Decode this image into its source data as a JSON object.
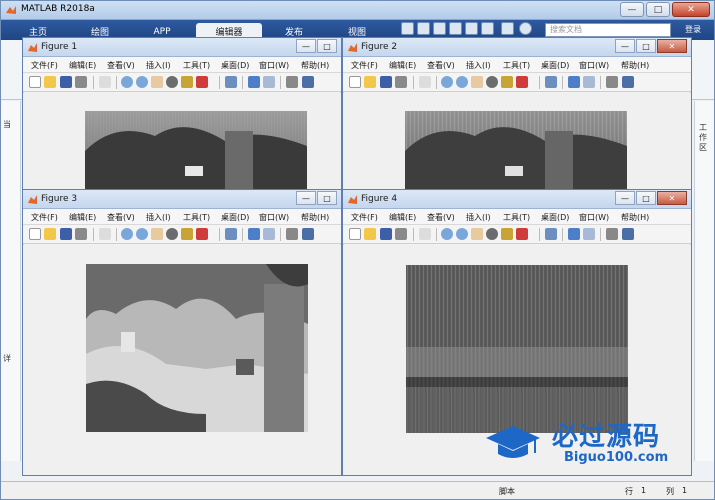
{
  "app": {
    "title": "MATLAB R2018a",
    "tabs": [
      "主页",
      "绘图",
      "APP",
      "编辑器",
      "发布",
      "视图"
    ],
    "active_tab": "编辑器",
    "search_placeholder": "搜索文档",
    "login_label": "登录",
    "left_labels": [
      "当",
      "详"
    ],
    "right_panel_label": "工作区",
    "statusbar": {
      "mode": "脚本",
      "row_label": "行",
      "row_value": "1",
      "col_label": "列",
      "col_value": "1"
    }
  },
  "figures": [
    {
      "title": "Figure 1",
      "image": "photo-gray-1"
    },
    {
      "title": "Figure 2",
      "image": "photo-gray-2"
    },
    {
      "title": "Figure 3",
      "image": "photo-gray-3"
    },
    {
      "title": "Figure 4",
      "image": "spectrum-bands"
    }
  ],
  "figure_menu": [
    "文件(F)",
    "编辑(E)",
    "查看(V)",
    "插入(I)",
    "工具(T)",
    "桌面(D)",
    "窗口(W)",
    "帮助(H)"
  ],
  "window_buttons": {
    "minimize": "—",
    "maximize": "□",
    "close": "✕"
  },
  "toolbar_icons": [
    "new-figure-icon",
    "open-icon",
    "save-icon",
    "print-icon",
    "pointer-icon",
    "zoom-in-icon",
    "zoom-out-icon",
    "pan-icon",
    "rotate-icon",
    "data-cursor-icon",
    "brush-icon",
    "link-icon",
    "colorbar-icon",
    "legend-icon",
    "hide-tools-icon",
    "show-tools-icon"
  ],
  "watermark": {
    "name": "必过源码",
    "url": "Biguo100.com"
  },
  "colors": {
    "ribbon": "#1f4684",
    "titlebar": "#c5d7ee",
    "accent": "#1d67c7"
  }
}
